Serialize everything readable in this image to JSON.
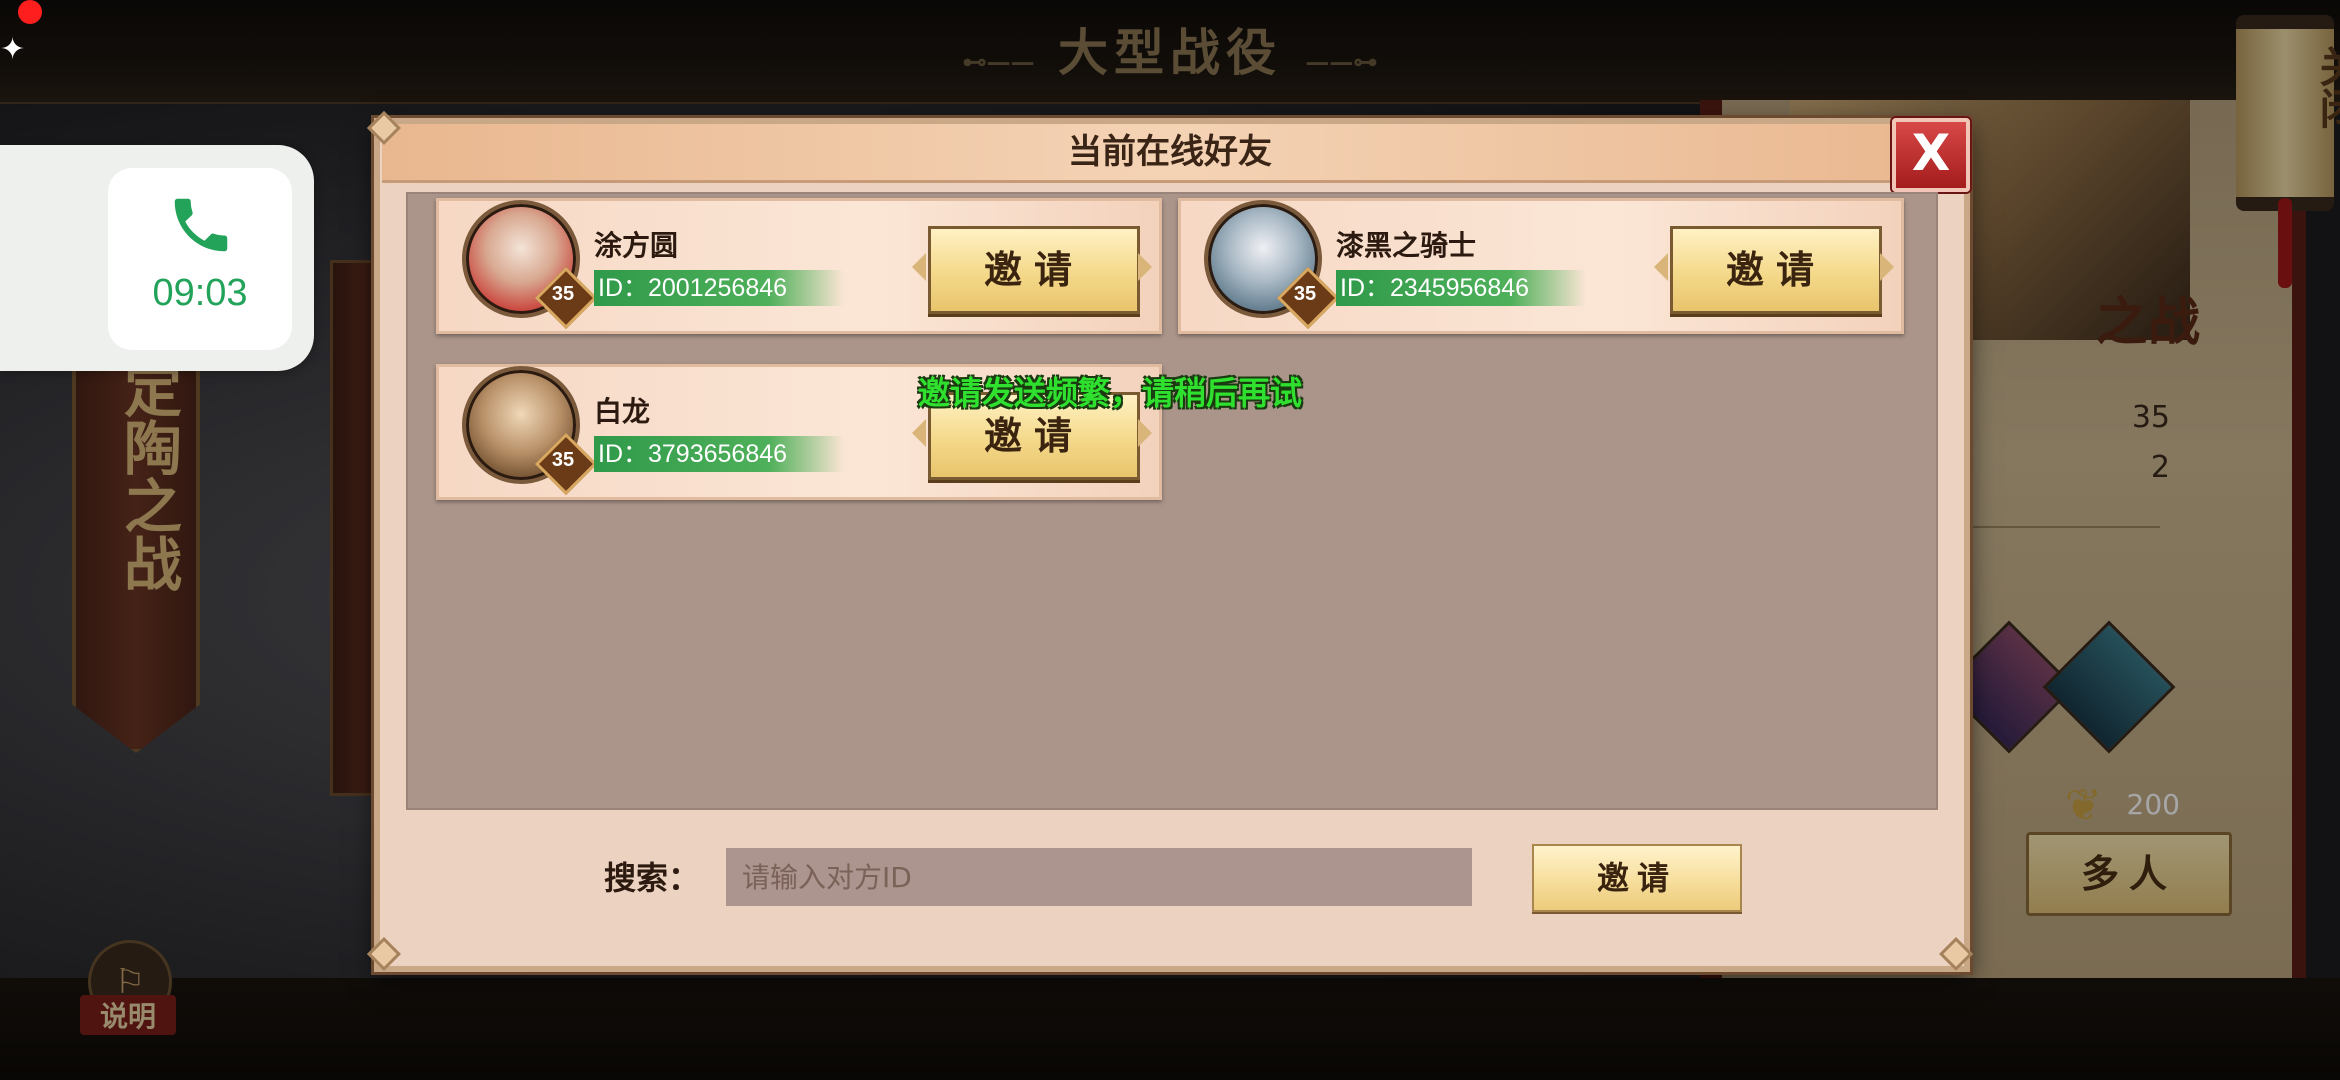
{
  "background": {
    "screen_title": "大型战役",
    "left_banner_text": "定陶之战",
    "right_panel": {
      "art_text": "之战",
      "stats": [
        {
          "label": ":",
          "value": "35"
        },
        {
          "label": ":",
          "value": "2"
        }
      ],
      "heroes_label": ":",
      "grain_count": "200",
      "multi_button": "多人"
    },
    "close_scroll_text": "关闭",
    "help_label": "说明"
  },
  "call_widget": {
    "time": "09:03"
  },
  "dialog": {
    "title": "当前在线好友",
    "close_glyph": "X",
    "friends": [
      {
        "name": "涂方圆",
        "id_text": "ID：2001256846",
        "level": "35",
        "invite_label": "邀请",
        "avatar_color": "#c9413a"
      },
      {
        "name": "漆黑之骑士",
        "id_text": "ID：2345956846",
        "level": "35",
        "invite_label": "邀请",
        "avatar_color": "#5f7a8c"
      },
      {
        "name": "白龙",
        "id_text": "ID：3793656846",
        "level": "35",
        "invite_label": "邀请",
        "avatar_color": "#8a6a4a"
      }
    ],
    "toast": "邀请发送频繁，请稍后再试",
    "search": {
      "label": "搜索：",
      "placeholder": "请输入对方ID",
      "value": "",
      "invite_label": "邀请"
    }
  },
  "colors": {
    "dialog_bg": "#ecd2c0",
    "list_bg": "#ab958b",
    "id_bar": "#3aa04f",
    "toast": "#2fe02f",
    "call_time": "#23a35a"
  }
}
